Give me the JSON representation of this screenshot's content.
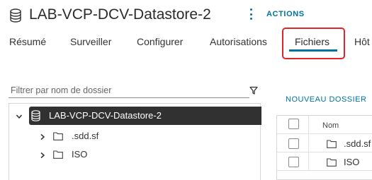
{
  "header": {
    "title": "LAB-VCP-DCV-Datastore-2",
    "title_icon": "datastore-icon",
    "actions_label": "ACTIONS"
  },
  "tabs": [
    {
      "label": "Résumé",
      "active": false
    },
    {
      "label": "Surveiller",
      "active": false
    },
    {
      "label": "Configurer",
      "active": false
    },
    {
      "label": "Autorisations",
      "active": false
    },
    {
      "label": "Fichiers",
      "active": true
    },
    {
      "label": "Hôt",
      "active": false
    }
  ],
  "filter": {
    "placeholder": "Filtrer par nom de dossier",
    "value": ""
  },
  "tree": {
    "root": {
      "label": "LAB-VCP-DCV-Datastore-2",
      "icon": "datastore-icon",
      "selected": true,
      "expanded": true
    },
    "children": [
      {
        "label": ".sdd.sf",
        "icon": "folder-icon"
      },
      {
        "label": "ISO",
        "icon": "folder-icon"
      }
    ]
  },
  "files": {
    "new_folder_label": "NOUVEAU DOSSIER",
    "column_name": "Nom",
    "rows": [
      {
        "name": ".sdd.sf",
        "icon": "folder-icon"
      },
      {
        "name": "ISO",
        "icon": "folder-icon"
      }
    ]
  },
  "colors": {
    "accent": "#0072a3",
    "highlight": "#e0242a",
    "selection": "#313131"
  }
}
